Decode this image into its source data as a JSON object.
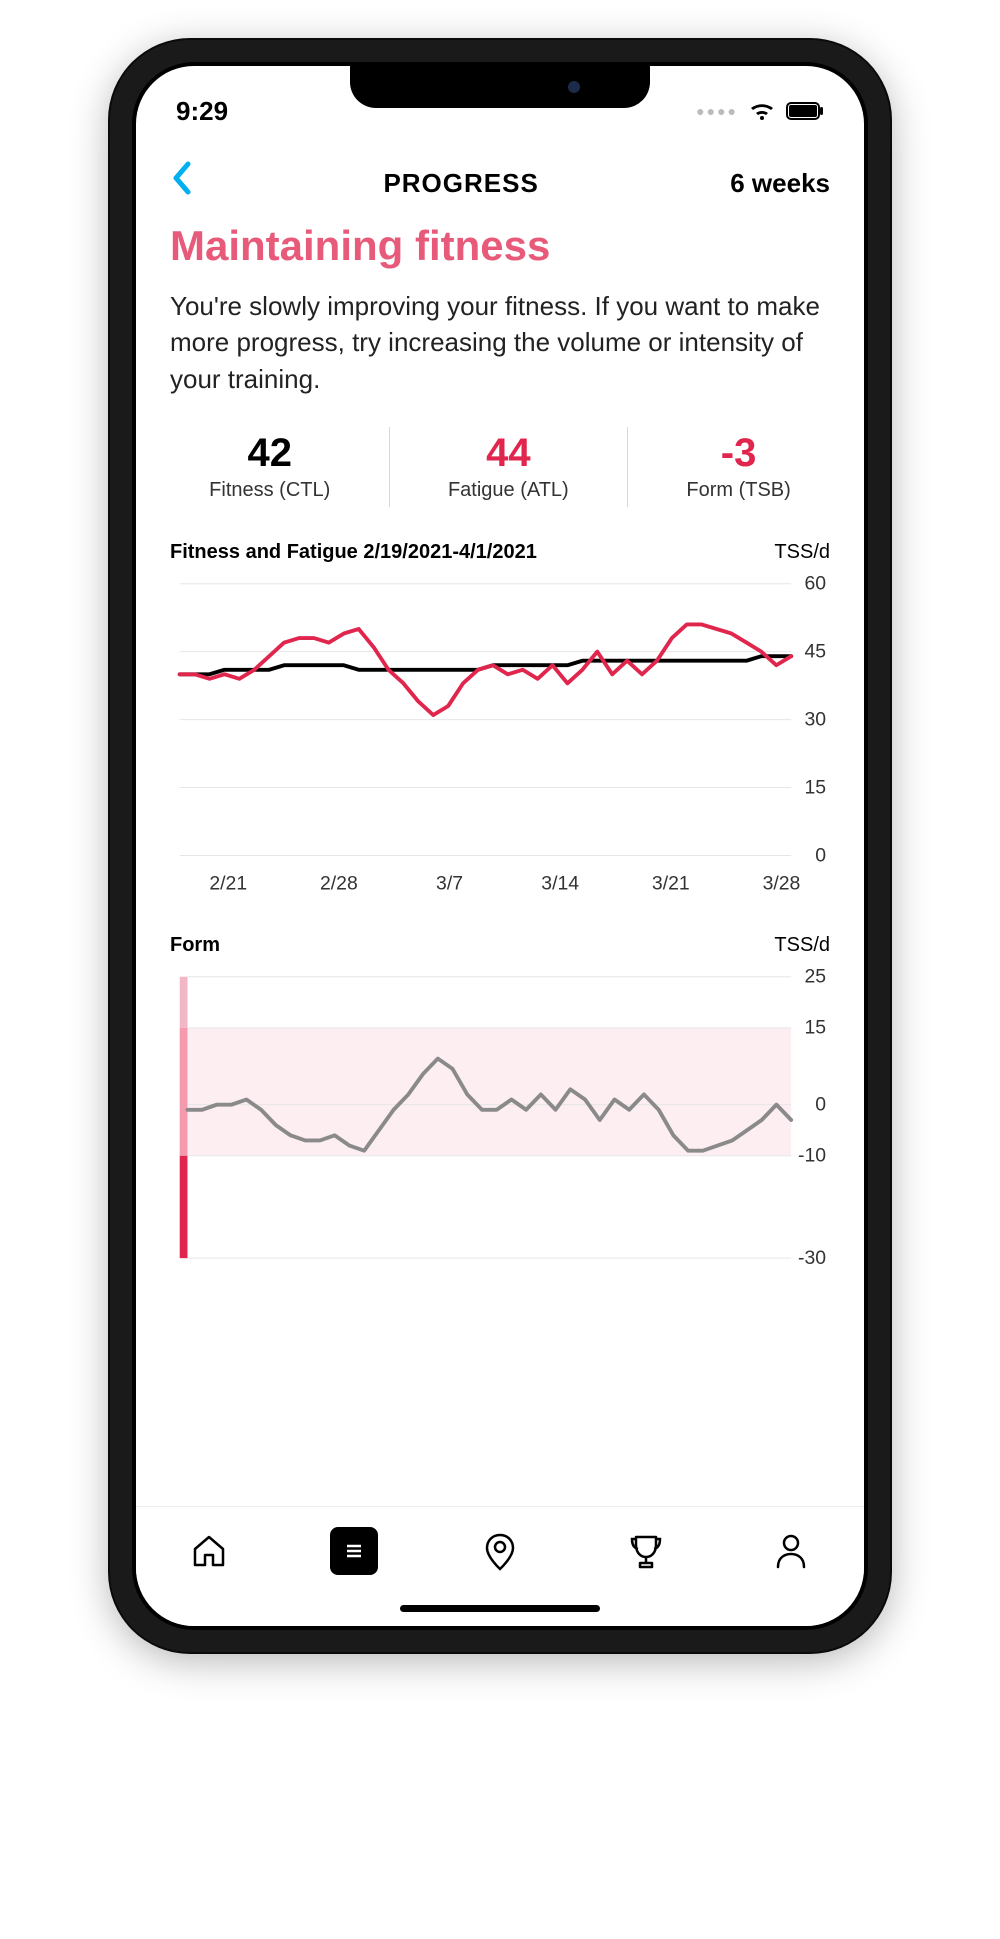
{
  "status": {
    "time": "9:29"
  },
  "nav": {
    "title": "PROGRESS",
    "range": "6 weeks"
  },
  "headline": "Maintaining fitness",
  "body": "You're slowly improving your fitness. If you want to make more progress, try increasing the volume or intensity of your training.",
  "metrics": {
    "fitness": {
      "value": "42",
      "label": "Fitness (CTL)"
    },
    "fatigue": {
      "value": "44",
      "label": "Fatigue (ATL)"
    },
    "form": {
      "value": "-3",
      "label": "Form (TSB)"
    }
  },
  "chart1": {
    "title": "Fitness and Fatigue 2/19/2021-4/1/2021",
    "unit": "TSS/d",
    "yticks": [
      "0",
      "15",
      "30",
      "45",
      "60"
    ],
    "xticks": [
      "2/21",
      "2/28",
      "3/7",
      "3/14",
      "3/21",
      "3/28"
    ]
  },
  "chart2": {
    "title": "Form",
    "unit": "TSS/d",
    "yticks": [
      "-30",
      "-10",
      "0",
      "15",
      "25"
    ]
  },
  "chart_data": [
    {
      "type": "line",
      "title": "Fitness and Fatigue 2/19/2021-4/1/2021",
      "ylabel": "TSS/d",
      "ylim": [
        0,
        60
      ],
      "x_categories": [
        "2/21",
        "2/28",
        "3/7",
        "3/14",
        "3/21",
        "3/28"
      ],
      "series": [
        {
          "name": "Fitness (CTL)",
          "color": "#000000",
          "values": [
            40,
            40,
            40,
            41,
            41,
            41,
            41,
            42,
            42,
            42,
            42,
            42,
            41,
            41,
            41,
            41,
            41,
            41,
            41,
            41,
            41,
            42,
            42,
            42,
            42,
            42,
            42,
            43,
            43,
            43,
            43,
            43,
            43,
            43,
            43,
            43,
            43,
            43,
            43,
            44,
            44,
            44
          ]
        },
        {
          "name": "Fatigue (ATL)",
          "color": "#e0264d",
          "values": [
            40,
            40,
            39,
            40,
            39,
            41,
            44,
            47,
            48,
            48,
            47,
            49,
            50,
            46,
            41,
            38,
            34,
            31,
            33,
            38,
            41,
            42,
            40,
            41,
            39,
            42,
            38,
            41,
            45,
            40,
            43,
            40,
            43,
            48,
            51,
            51,
            50,
            49,
            47,
            45,
            42,
            44
          ]
        }
      ]
    },
    {
      "type": "line",
      "title": "Form",
      "ylabel": "TSS/d",
      "ylim": [
        -30,
        25
      ],
      "series": [
        {
          "name": "Form (TSB)",
          "color": "#8a8a8a",
          "values": [
            -1,
            -1,
            0,
            0,
            1,
            -1,
            -4,
            -6,
            -7,
            -7,
            -6,
            -8,
            -9,
            -5,
            -1,
            2,
            6,
            9,
            7,
            2,
            -1,
            -1,
            1,
            -1,
            2,
            -1,
            3,
            1,
            -3,
            1,
            -1,
            2,
            -1,
            -6,
            -9,
            -9,
            -8,
            -7,
            -5,
            -3,
            0,
            -3
          ]
        }
      ]
    }
  ]
}
